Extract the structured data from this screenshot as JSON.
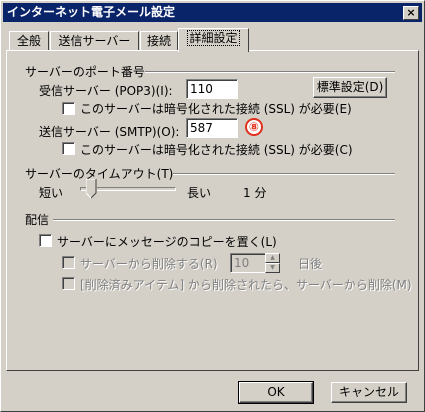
{
  "window": {
    "title": "インターネット電子メール設定",
    "close": "×"
  },
  "tabs": [
    {
      "label": "全般"
    },
    {
      "label": "送信サーバー"
    },
    {
      "label": "接続"
    },
    {
      "label": "詳細設定"
    }
  ],
  "ports": {
    "section": "サーバーのポート番号",
    "incoming_label": "受信サーバー (POP3)(I):",
    "incoming_value": "110",
    "default_button": "標準設定(D)",
    "incoming_ssl": "このサーバーは暗号化された接続 (SSL) が必要(E)",
    "outgoing_label": "送信サーバー (SMTP)(O):",
    "outgoing_value": "587",
    "badge": "⑧",
    "outgoing_ssl": "このサーバーは暗号化された接続 (SSL) が必要(C)"
  },
  "timeout": {
    "section": "サーバーのタイムアウト(T)",
    "short": "短い",
    "long": "長い",
    "value": "1 分",
    "slider_position": 0.07
  },
  "delivery": {
    "section": "配信",
    "leave_copy": "サーバーにメッセージのコピーを置く(L)",
    "remove_after": "サーバーから削除する(R)",
    "days_value": "10",
    "days_unit": "日後",
    "remove_deleted": "[削除済みアイテム] から削除されたら、サーバーから削除(M)"
  },
  "buttons": {
    "ok": "OK",
    "cancel": "キャンセル"
  }
}
